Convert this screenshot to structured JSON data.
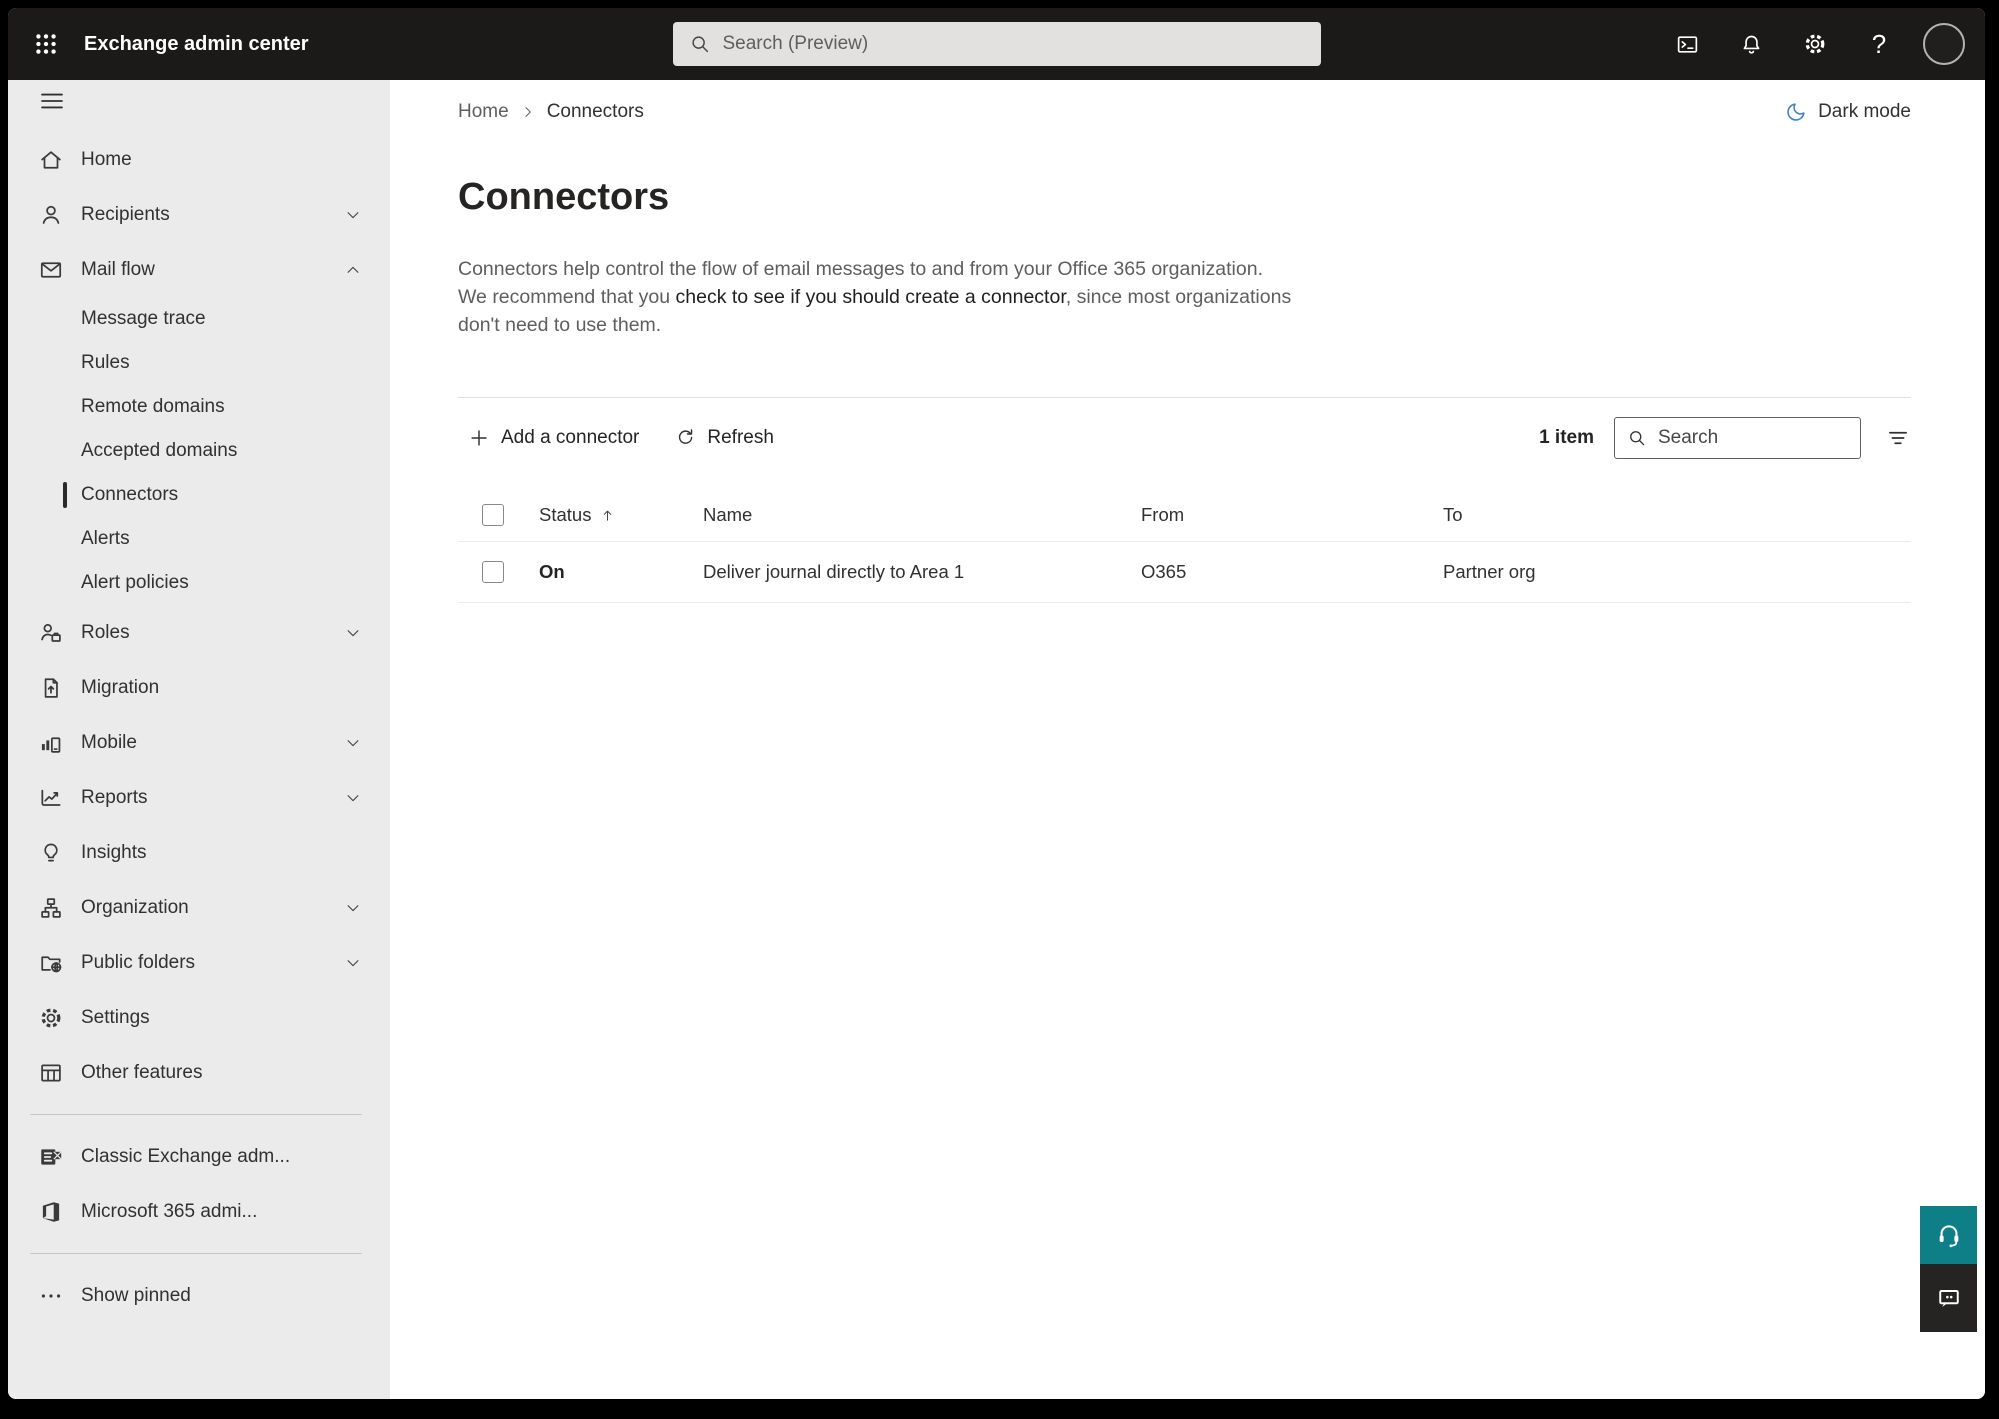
{
  "topbar": {
    "title": "Exchange admin center",
    "search_placeholder": "Search (Preview)"
  },
  "breadcrumb": {
    "items": [
      "Home",
      "Connectors"
    ]
  },
  "dark_mode": {
    "label": "Dark mode"
  },
  "page": {
    "title": "Connectors",
    "description_prefix": "Connectors help control the flow of email messages to and from your Office 365 organization. We recommend that you ",
    "description_link": "check to see if you should create a connector",
    "description_suffix": ", since most organizations don't need to use them."
  },
  "toolbar": {
    "add_label": "Add a connector",
    "refresh_label": "Refresh",
    "item_count": "1 item",
    "search_placeholder": "Search"
  },
  "table": {
    "headers": {
      "status": "Status",
      "name": "Name",
      "from": "From",
      "to": "To"
    },
    "sort": {
      "column": "Status",
      "direction": "ascending"
    },
    "rows": [
      {
        "status": "On",
        "name": "Deliver journal directly to Area 1",
        "from": "O365",
        "to": "Partner org"
      }
    ]
  },
  "sidebar": {
    "items": [
      {
        "label": "Home"
      },
      {
        "label": "Recipients",
        "expandable": true
      },
      {
        "label": "Mail flow",
        "expandable": true,
        "expanded": true
      },
      {
        "label": "Message trace"
      },
      {
        "label": "Rules"
      },
      {
        "label": "Remote domains"
      },
      {
        "label": "Accepted domains"
      },
      {
        "label": "Connectors",
        "selected": true
      },
      {
        "label": "Alerts"
      },
      {
        "label": "Alert policies"
      },
      {
        "label": "Roles",
        "expandable": true
      },
      {
        "label": "Migration"
      },
      {
        "label": "Mobile",
        "expandable": true
      },
      {
        "label": "Reports",
        "expandable": true
      },
      {
        "label": "Insights"
      },
      {
        "label": "Organization",
        "expandable": true
      },
      {
        "label": "Public folders",
        "expandable": true
      },
      {
        "label": "Settings"
      },
      {
        "label": "Other features"
      },
      {
        "label": "Classic Exchange adm..."
      },
      {
        "label": "Microsoft 365 admi..."
      },
      {
        "label": "Show pinned"
      }
    ]
  },
  "icons": {
    "help_glyph": "?"
  },
  "colors": {
    "topbar_bg": "#1B1A19",
    "sidebar_bg": "#EBEBEB",
    "accent_teal": "#0E7E87",
    "moon_blue": "#3E7FD1",
    "text_primary": "#323130",
    "text_secondary": "#605E5C"
  }
}
